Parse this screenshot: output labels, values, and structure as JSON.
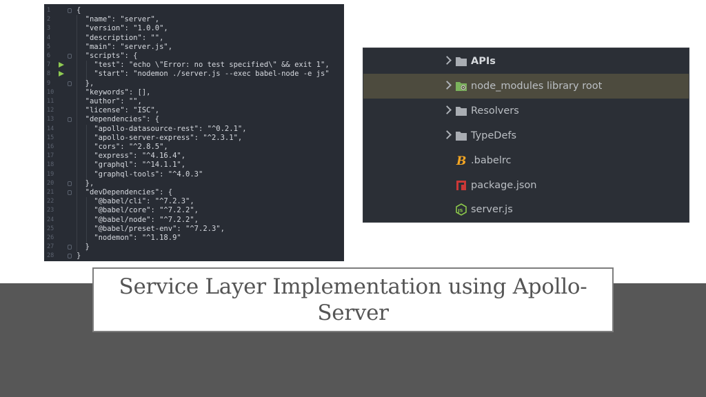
{
  "code_editor": {
    "lines": [
      {
        "n": "1",
        "text": "{"
      },
      {
        "n": "2",
        "text": "  \"name\": \"server\","
      },
      {
        "n": "3",
        "text": "  \"version\": \"1.0.0\","
      },
      {
        "n": "4",
        "text": "  \"description\": \"\","
      },
      {
        "n": "5",
        "text": "  \"main\": \"server.js\","
      },
      {
        "n": "6",
        "text": "  \"scripts\": {"
      },
      {
        "n": "7",
        "text": "    \"test\": \"echo \\\"Error: no test specified\\\" && exit 1\","
      },
      {
        "n": "8",
        "text": "    \"start\": \"nodemon ./server.js --exec babel-node -e js\""
      },
      {
        "n": "9",
        "text": "  },"
      },
      {
        "n": "10",
        "text": "  \"keywords\": [],"
      },
      {
        "n": "11",
        "text": "  \"author\": \"\","
      },
      {
        "n": "12",
        "text": "  \"license\": \"ISC\","
      },
      {
        "n": "13",
        "text": "  \"dependencies\": {"
      },
      {
        "n": "14",
        "text": "    \"apollo-datasource-rest\": \"^0.2.1\","
      },
      {
        "n": "15",
        "text": "    \"apollo-server-express\": \"^2.3.1\","
      },
      {
        "n": "16",
        "text": "    \"cors\": \"^2.8.5\","
      },
      {
        "n": "17",
        "text": "    \"express\": \"^4.16.4\","
      },
      {
        "n": "18",
        "text": "    \"graphql\": \"^14.1.1\","
      },
      {
        "n": "19",
        "text": "    \"graphql-tools\": \"^4.0.3\""
      },
      {
        "n": "20",
        "text": "  },"
      },
      {
        "n": "21",
        "text": "  \"devDependencies\": {"
      },
      {
        "n": "22",
        "text": "    \"@babel/cli\": \"^7.2.3\","
      },
      {
        "n": "23",
        "text": "    \"@babel/core\": \"^7.2.2\","
      },
      {
        "n": "24",
        "text": "    \"@babel/node\": \"^7.2.2\","
      },
      {
        "n": "25",
        "text": "    \"@babel/preset-env\": \"^7.2.3\","
      },
      {
        "n": "26",
        "text": "    \"nodemon\": \"^1.18.9\""
      },
      {
        "n": "27",
        "text": "  }"
      },
      {
        "n": "28",
        "text": "}"
      }
    ],
    "run_lines": [
      "7",
      "8"
    ],
    "fold_lines": [
      "1",
      "6",
      "9",
      "13",
      "20",
      "21",
      "27",
      "28"
    ]
  },
  "project_tree": {
    "items": [
      {
        "label": "APIs",
        "type": "folder",
        "expandable": true,
        "selected": false,
        "icon": "folder-icon"
      },
      {
        "label": "node_modules",
        "suffix": "library root",
        "type": "library-folder",
        "expandable": true,
        "selected": true,
        "icon": "library-folder-icon"
      },
      {
        "label": "Resolvers",
        "type": "folder",
        "expandable": true,
        "selected": false,
        "icon": "folder-icon"
      },
      {
        "label": "TypeDefs",
        "type": "folder",
        "expandable": true,
        "selected": false,
        "icon": "folder-icon"
      },
      {
        "label": ".babelrc",
        "type": "file",
        "expandable": false,
        "selected": false,
        "icon": "babel-icon"
      },
      {
        "label": "package.json",
        "type": "file",
        "expandable": false,
        "selected": false,
        "icon": "npm-icon"
      },
      {
        "label": "server.js",
        "type": "file",
        "expandable": false,
        "selected": false,
        "icon": "nodejs-icon"
      }
    ]
  },
  "slide": {
    "title": "Service Layer Implementation using Apollo-Server"
  },
  "colors": {
    "accent_run": "#8fcb52",
    "selection": "#4d4b3e",
    "band": "#575757"
  }
}
